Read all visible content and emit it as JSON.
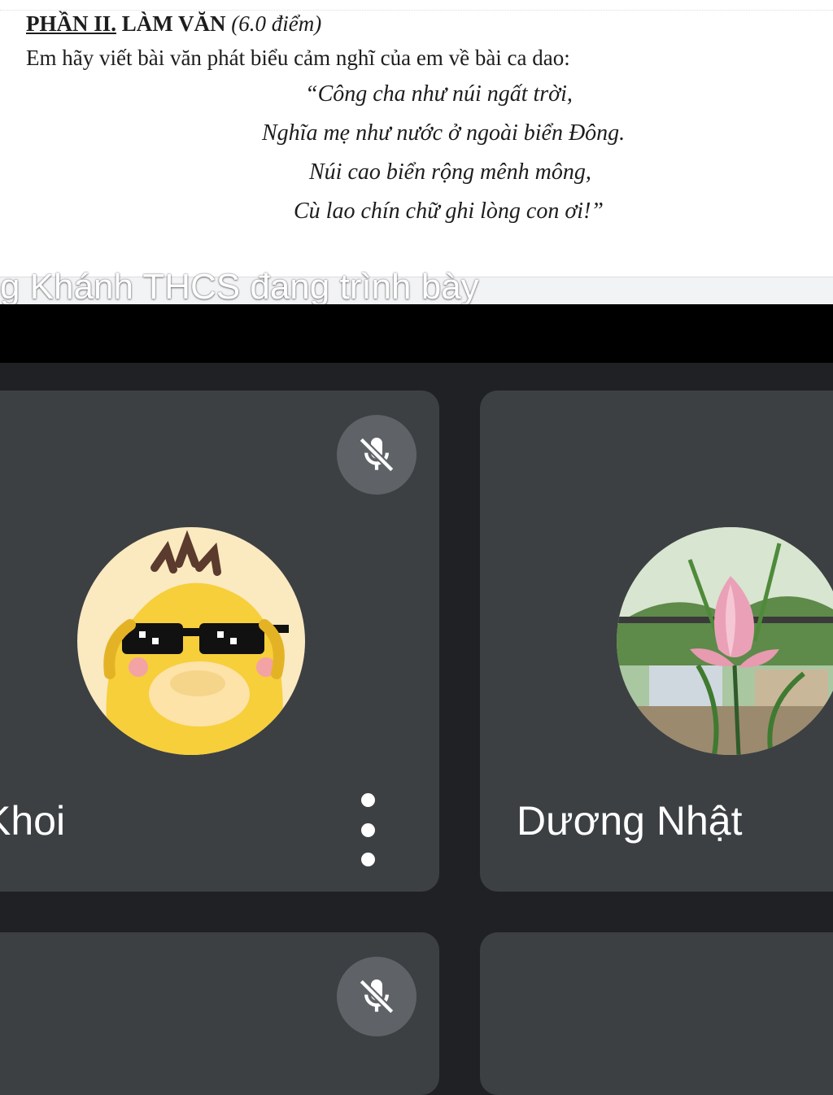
{
  "document": {
    "heading_part": "PHẦN II.",
    "heading_title": "LÀM VĂN",
    "heading_score": "(6.0 điểm)",
    "prompt": "Em hãy viết bài văn phát biểu cảm nghĩ của em về bài ca dao:",
    "poem": [
      "“Công cha như núi ngất trời,",
      "Nghĩa mẹ như nước ở ngoài biển Đông.",
      "Núi cao biển rộng mênh mông,",
      "Cù lao chín chữ ghi lòng con ơi!”"
    ]
  },
  "presenting_banner": "g Khánh THCS đang trình bày",
  "participants": [
    {
      "name": "Khoi",
      "muted": true,
      "avatar": "psyduck-sunglasses-avatar",
      "has_more_options": true
    },
    {
      "name": "Dương Nhật",
      "muted": false,
      "avatar": "lotus-flower-avatar",
      "has_more_options": false
    },
    {
      "name": "",
      "muted": true,
      "avatar": "",
      "has_more_options": false
    },
    {
      "name": "",
      "muted": false,
      "avatar": "",
      "has_more_options": false
    }
  ],
  "icons": {
    "mic_off": "mic-off-icon",
    "more": "more-vert-icon"
  },
  "colors": {
    "background": "#202124",
    "tile": "#3c4043",
    "mic_badge": "#5f6368",
    "document": "#ffffff",
    "text_on_dark": "#ffffff"
  }
}
